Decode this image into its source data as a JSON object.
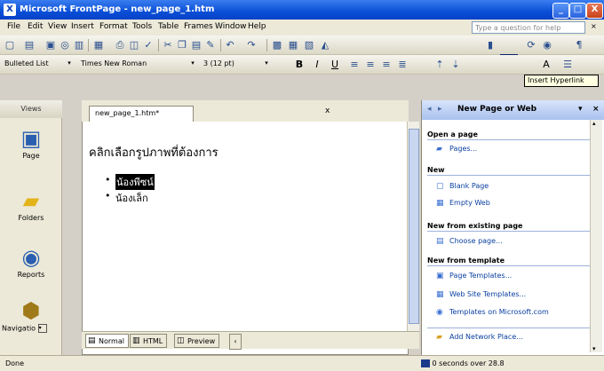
{
  "window": {
    "title": "Microsoft FrontPage - new_page_1.htm",
    "app_icon": "X",
    "minimize": "_",
    "maximize": "□",
    "close": "X"
  },
  "menu": {
    "items": [
      "File",
      "Edit",
      "View",
      "Insert",
      "Format",
      "Tools",
      "Table",
      "Frames",
      "Window",
      "Help"
    ],
    "ask_placeholder": "Type a question for help"
  },
  "formatting": {
    "style": "Bulleted List",
    "font": "Times New Roman",
    "size": "3 (12 pt)",
    "bold": "B",
    "italic": "I",
    "underline": "U",
    "font_grow": "A"
  },
  "tooltip": "Insert Hyperlink",
  "views": {
    "header": "Views",
    "items": [
      {
        "label": "Page",
        "icon": "page-view-icon"
      },
      {
        "label": "Folders",
        "icon": "folders-view-icon"
      },
      {
        "label": "Reports",
        "icon": "reports-view-icon"
      },
      {
        "label": "Navigatio",
        "icon": "navigation-view-icon"
      }
    ]
  },
  "editor": {
    "tab_label": "new_page_1.htm*",
    "close": "x",
    "heading": "คลิกเลือกรูปภาพที่ต้องการ",
    "bullets": [
      {
        "text": "น้องพีซน์",
        "selected": true
      },
      {
        "text": "น้องเล็ก",
        "selected": false
      }
    ],
    "view_tabs": [
      {
        "label": "Normal",
        "active": true
      },
      {
        "label": "HTML",
        "active": false
      },
      {
        "label": "Preview",
        "active": false
      }
    ]
  },
  "taskpane": {
    "title": "New Page or Web",
    "sections": [
      {
        "title": "Open a page",
        "links": [
          "Pages..."
        ]
      },
      {
        "title": "New",
        "links": [
          "Blank Page",
          "Empty Web"
        ]
      },
      {
        "title": "New from existing page",
        "links": [
          "Choose page..."
        ]
      },
      {
        "title": "New from template",
        "links": [
          "Page Templates...",
          "Web Site Templates...",
          "Templates on Microsoft.com"
        ]
      }
    ],
    "footer_link": "Add Network Place..."
  },
  "status": {
    "left": "Done",
    "right": "0 seconds over 28.8"
  }
}
